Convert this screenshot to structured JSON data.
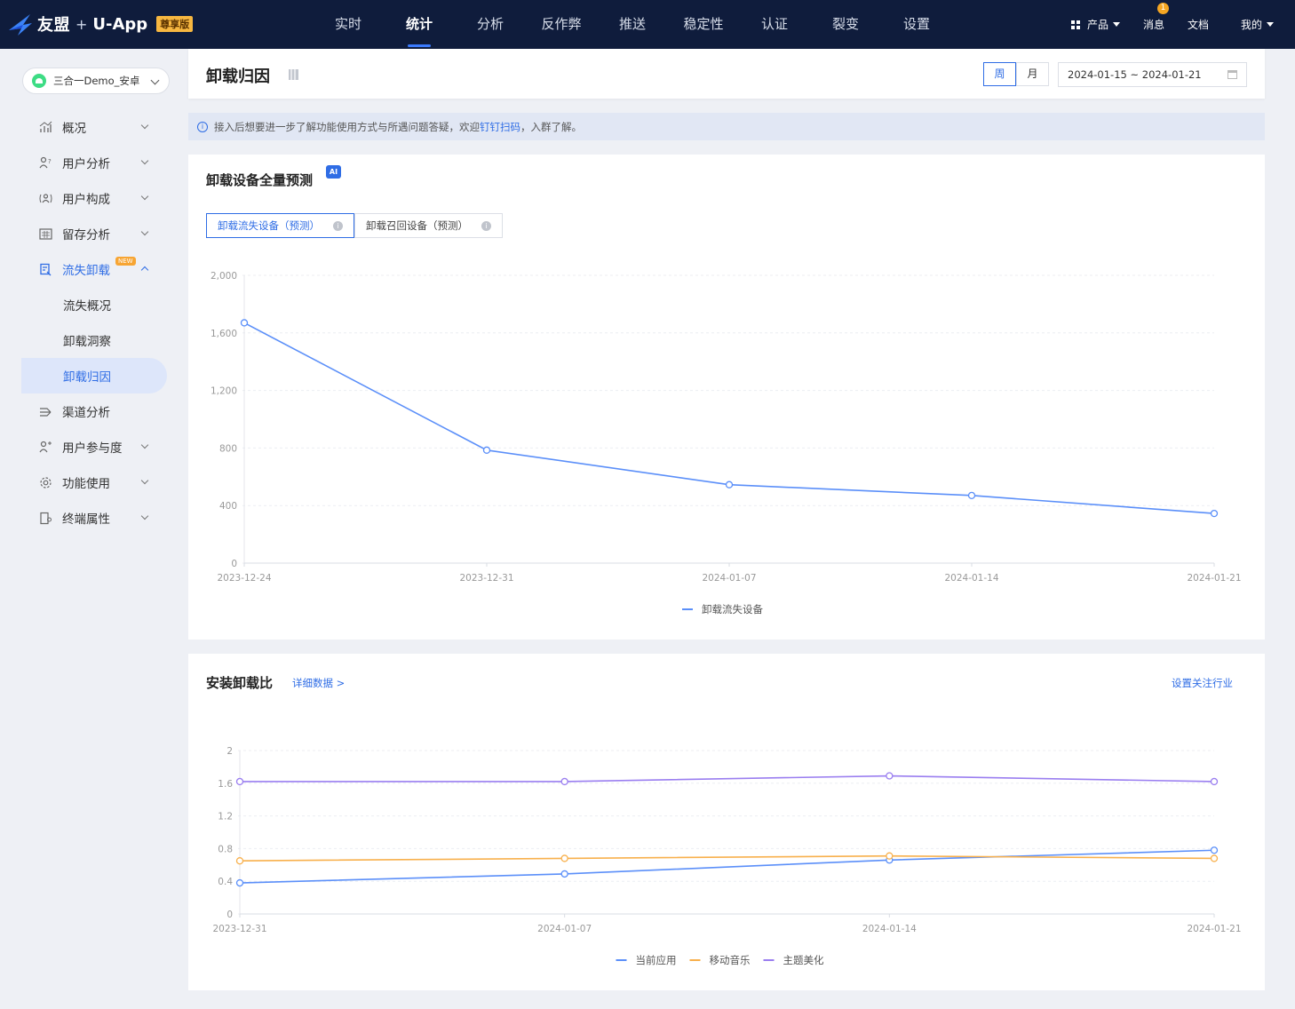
{
  "topbar": {
    "brand": "友盟",
    "plus": "+",
    "product": "U-App",
    "edition_badge": "尊享版",
    "nav": [
      "实时",
      "统计",
      "分析",
      "反作弊",
      "推送",
      "稳定性",
      "认证",
      "裂变",
      "设置"
    ],
    "active_nav": "统计",
    "right": {
      "products": "产品",
      "messages": "消息",
      "message_count": "1",
      "docs": "文档",
      "mine": "我的"
    }
  },
  "sidebar": {
    "app_name": "三合一Demo_安卓",
    "items": [
      {
        "label": "概况",
        "icon": "bar-chart-icon",
        "expandable": true
      },
      {
        "label": "用户分析",
        "icon": "user-question-icon",
        "expandable": true
      },
      {
        "label": "用户构成",
        "icon": "user-composition-icon",
        "expandable": true
      },
      {
        "label": "留存分析",
        "icon": "calendar-grid-icon",
        "expandable": true
      },
      {
        "label": "流失卸载",
        "icon": "uninstall-icon",
        "expandable": true,
        "open": true,
        "badge": "NEW",
        "children": [
          "流失概况",
          "卸载洞察",
          "卸载归因"
        ]
      },
      {
        "label": "渠道分析",
        "icon": "channel-icon",
        "expandable": false
      },
      {
        "label": "用户参与度",
        "icon": "engagement-icon",
        "expandable": true
      },
      {
        "label": "功能使用",
        "icon": "gear-icon",
        "expandable": true
      },
      {
        "label": "终端属性",
        "icon": "device-icon",
        "expandable": true
      }
    ],
    "active_sub": "卸载归因"
  },
  "header": {
    "title": "卸载归因",
    "period_week": "周",
    "period_month": "月",
    "date_range": "2024-01-15 ~ 2024-01-21"
  },
  "info": {
    "text_before": "接入后想要进一步了解功能使用方式与所遇问题答疑，欢迎",
    "link": "钉钉扫码",
    "text_after": "，入群了解。"
  },
  "card1": {
    "title": "卸载设备全量预测",
    "ai_badge": "AI",
    "tab_active": "卸载流失设备（预测）",
    "tab_other": "卸载召回设备（预测）"
  },
  "card2": {
    "title": "安装卸载比",
    "detail_link": "详细数据 >",
    "industry_link": "设置关注行业"
  },
  "colors": {
    "accent": "#2f6de5",
    "series_blue": "#5b8ff9",
    "series_orange": "#f8b04c",
    "series_purple": "#9a7ef0"
  },
  "chart_data": [
    {
      "type": "line",
      "categories": [
        "2023-12-24",
        "2023-12-31",
        "2024-01-07",
        "2024-01-14",
        "2024-01-21"
      ],
      "series": [
        {
          "name": "卸载流失设备",
          "values": [
            1670,
            785,
            545,
            470,
            345
          ]
        }
      ],
      "yticks": [
        "0",
        "400",
        "800",
        "1,200",
        "1,600",
        "2,000"
      ],
      "ylim": [
        0,
        2000
      ],
      "grid": true,
      "legend": "bottom"
    },
    {
      "type": "line",
      "categories": [
        "2023-12-31",
        "2024-01-07",
        "2024-01-14",
        "2024-01-21"
      ],
      "series": [
        {
          "name": "当前应用",
          "values": [
            0.38,
            0.49,
            0.66,
            0.78
          ]
        },
        {
          "name": "移动音乐",
          "values": [
            0.65,
            0.68,
            0.71,
            0.68
          ]
        },
        {
          "name": "主题美化",
          "values": [
            1.62,
            1.62,
            1.69,
            1.62
          ]
        }
      ],
      "yticks": [
        "0",
        "0.4",
        "0.8",
        "1.2",
        "1.6",
        "2"
      ],
      "ylim": [
        0,
        2
      ],
      "grid": true,
      "legend": "bottom"
    }
  ]
}
